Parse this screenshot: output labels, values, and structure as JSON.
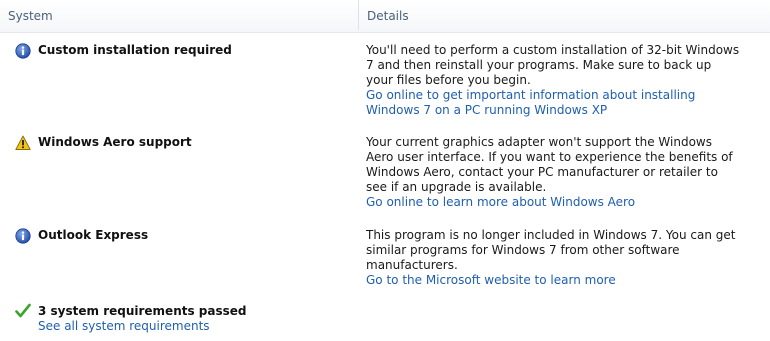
{
  "header": {
    "col_system": "System",
    "col_details": "Details"
  },
  "rows": [
    {
      "icon": "info-icon",
      "title": "Custom installation required",
      "details": "You'll need to perform a custom installation of 32-bit Windows 7 and then reinstall your programs. Make sure to back up your files before you begin.",
      "link": "Go online to get important information about installing Windows 7 on a PC running Windows XP"
    },
    {
      "icon": "warning-icon",
      "title": "Windows Aero support",
      "details": "Your current graphics adapter won't support the Windows Aero user interface. If you want to experience the benefits of Windows Aero, contact your PC manufacturer or retailer to see if an upgrade is available.",
      "link": "Go online to learn more about Windows Aero"
    },
    {
      "icon": "info-icon",
      "title": "Outlook Express",
      "details": "This program is no longer included in Windows 7. You can get similar programs for Windows 7 from other software manufacturers.",
      "link": "Go to the Microsoft website to learn more"
    }
  ],
  "passed": {
    "icon": "checkmark-icon",
    "title": "3 system requirements passed",
    "link": "See all system requirements"
  },
  "colors": {
    "link": "#1f5fb0",
    "header_text": "#4c607a",
    "info": "#2f5fb7",
    "warning": "#f2c417",
    "check": "#3aa52b"
  }
}
